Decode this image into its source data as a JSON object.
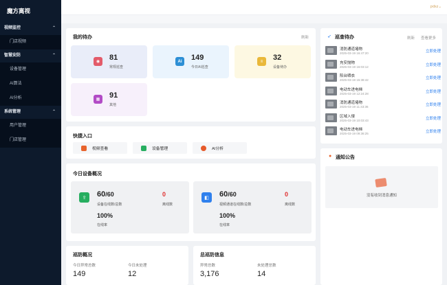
{
  "app": {
    "title": "魔方离视",
    "user": "ƿdxz⌄"
  },
  "sidebar": {
    "groups": [
      {
        "label": "视频监控",
        "items": [
          "门店视频"
        ]
      },
      {
        "label": "智慧安防",
        "items": [
          "设备管理",
          "AI算法",
          "AI分析"
        ]
      },
      {
        "label": "系统管理",
        "items": [
          "用户管理",
          "门店管理"
        ]
      }
    ]
  },
  "todo": {
    "title": "我的待办",
    "refresh": "刷新",
    "tiles": [
      {
        "value": "81",
        "label": "常规巡查",
        "icon": "shield-icon",
        "bg": "#e9edf9",
        "icon_color": "#e35b6a",
        "glyph": "◉"
      },
      {
        "value": "149",
        "label": "今日AI巡查",
        "icon": "ai-icon",
        "bg": "#eaf4fd",
        "icon_color": "#2d8fd5",
        "glyph": "Ai"
      },
      {
        "value": "32",
        "label": "设备待办",
        "icon": "document-icon",
        "bg": "#fdf8e2",
        "icon_color": "#e9b83a",
        "glyph": "≡"
      },
      {
        "value": "91",
        "label": "其他",
        "icon": "grid-icon",
        "bg": "#f7f0fb",
        "icon_color": "#b24cc6",
        "glyph": "▦"
      }
    ]
  },
  "quick": {
    "title": "快捷入口",
    "items": [
      {
        "label": "视频查看",
        "icon": "video-icon",
        "color": "#e8642d"
      },
      {
        "label": "设备管理",
        "icon": "device-icon",
        "color": "#27ae60"
      },
      {
        "label": "AI分析",
        "icon": "ai-analysis-icon",
        "color": "#e65a2a"
      }
    ]
  },
  "devices": {
    "title": "今日设备概况",
    "cards": [
      {
        "count": "60",
        "total": "/60",
        "count_label": "设备在线数/总数",
        "offline": "0",
        "offline_label": "离线数",
        "pct": "100%",
        "pct_label": "在线率",
        "icon": "upload-device-icon",
        "color": "#27ae60"
      },
      {
        "count": "60",
        "total": "/60",
        "count_label": "视频通道在线数/总数",
        "offline": "0",
        "offline_label": "离线数",
        "pct": "100%",
        "pct_label": "在线率",
        "icon": "camera-icon",
        "color": "#2f80ed"
      }
    ]
  },
  "patrol_summary": {
    "title": "巡防概况",
    "items": [
      {
        "label": "今日异常总数",
        "value": "149"
      },
      {
        "label": "今日未处理",
        "value": "12"
      }
    ]
  },
  "patrol_info": {
    "title": "总巡防信息",
    "items": [
      {
        "label": "异常总数",
        "value": "3,176"
      },
      {
        "label": "未处理总数",
        "value": "14"
      }
    ]
  },
  "patrol_todo": {
    "title": "巡查待办",
    "refresh": "刷新",
    "more": "查看更多",
    "action": "立即处理",
    "rows": [
      {
        "name": "消防通道堵物",
        "time": "2025-03-19 16:47:20"
      },
      {
        "name": "充安抛物",
        "time": "2025-03-19 16:03:12"
      },
      {
        "name": "阳台晒衣",
        "time": "2025-03-19 15:38:42"
      },
      {
        "name": "电动车进电梯",
        "time": "2025-03-19 12:24:28"
      },
      {
        "name": "消防通道堵物",
        "time": "2025-03-19 11:43:36"
      },
      {
        "name": "区域入侵",
        "time": "2025-03-19 10:03:43"
      },
      {
        "name": "电动车进电梯",
        "time": "2025-03-19 09:36:25"
      }
    ]
  },
  "notice": {
    "title": "通知公告",
    "empty": "没有收到消息通知"
  }
}
